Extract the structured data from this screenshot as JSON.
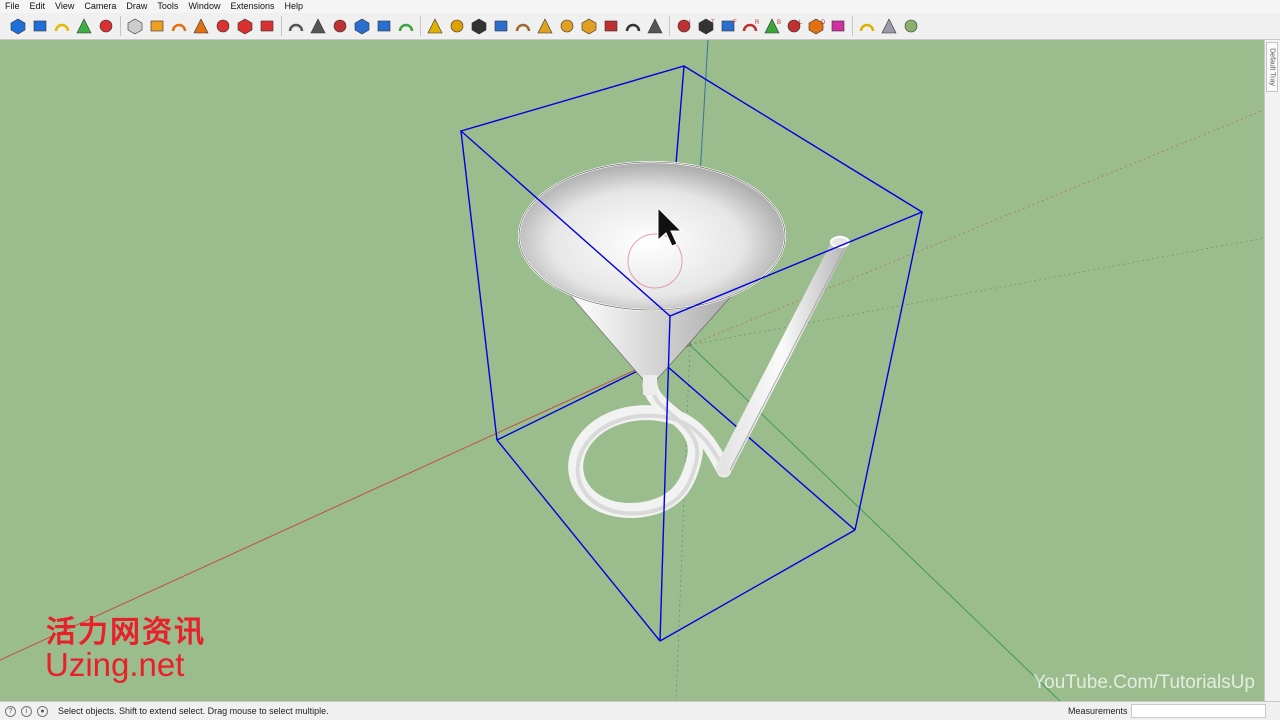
{
  "menu": [
    "File",
    "Edit",
    "View",
    "Camera",
    "Draw",
    "Tools",
    "Window",
    "Extensions",
    "Help"
  ],
  "toolbar": {
    "tools": [
      "components-icon",
      "materials-icon",
      "paint-bucket-icon",
      "3d-warehouse-icon",
      "sandbox-icon",
      "section-plane-icon",
      "follow-me-icon",
      "push-pull-icon",
      "rotate-icon",
      "rectangle-icon",
      "layers-icon",
      "scenes-icon",
      "arc-icon",
      "freehand-icon",
      "curve-icon",
      "bezier-icon",
      "polyline-icon",
      "cone-icon",
      "pyramid-icon",
      "lathe-icon",
      "orbit-icon",
      "pan-icon",
      "extrude-icon",
      "grid-icon",
      "grid-2-icon",
      "grid-3-icon",
      "vertex-icon",
      "lasso-icon",
      "select-group-icon",
      "view-iso-icon",
      "view-top-icon",
      "view-front-icon",
      "view-right-icon",
      "view-back-icon",
      "view-left-icon",
      "view-bottom-icon",
      "xray-icon",
      "box-yellow-icon",
      "box-gray-icon",
      "box-green-icon"
    ],
    "view_letters": [
      "I",
      "T",
      "F",
      "R",
      "B",
      "L",
      "D"
    ]
  },
  "tray": {
    "tab_label": "Default Tray"
  },
  "watermarks": {
    "cn": "活力网资讯",
    "url": "Uzing.net",
    "youtube": "YouTube.Com/TutorialsUp"
  },
  "status": {
    "message": "Select objects. Shift to extend select. Drag mouse to select multiple.",
    "measurements_label": "Measurements",
    "measurements_value": ""
  },
  "colors": {
    "viewport_bg": "#9bbd8e",
    "bounding_box": "#0000e0",
    "axis_red": "#c05040",
    "axis_green": "#3f9a4f",
    "watermark": "#e8202a"
  }
}
